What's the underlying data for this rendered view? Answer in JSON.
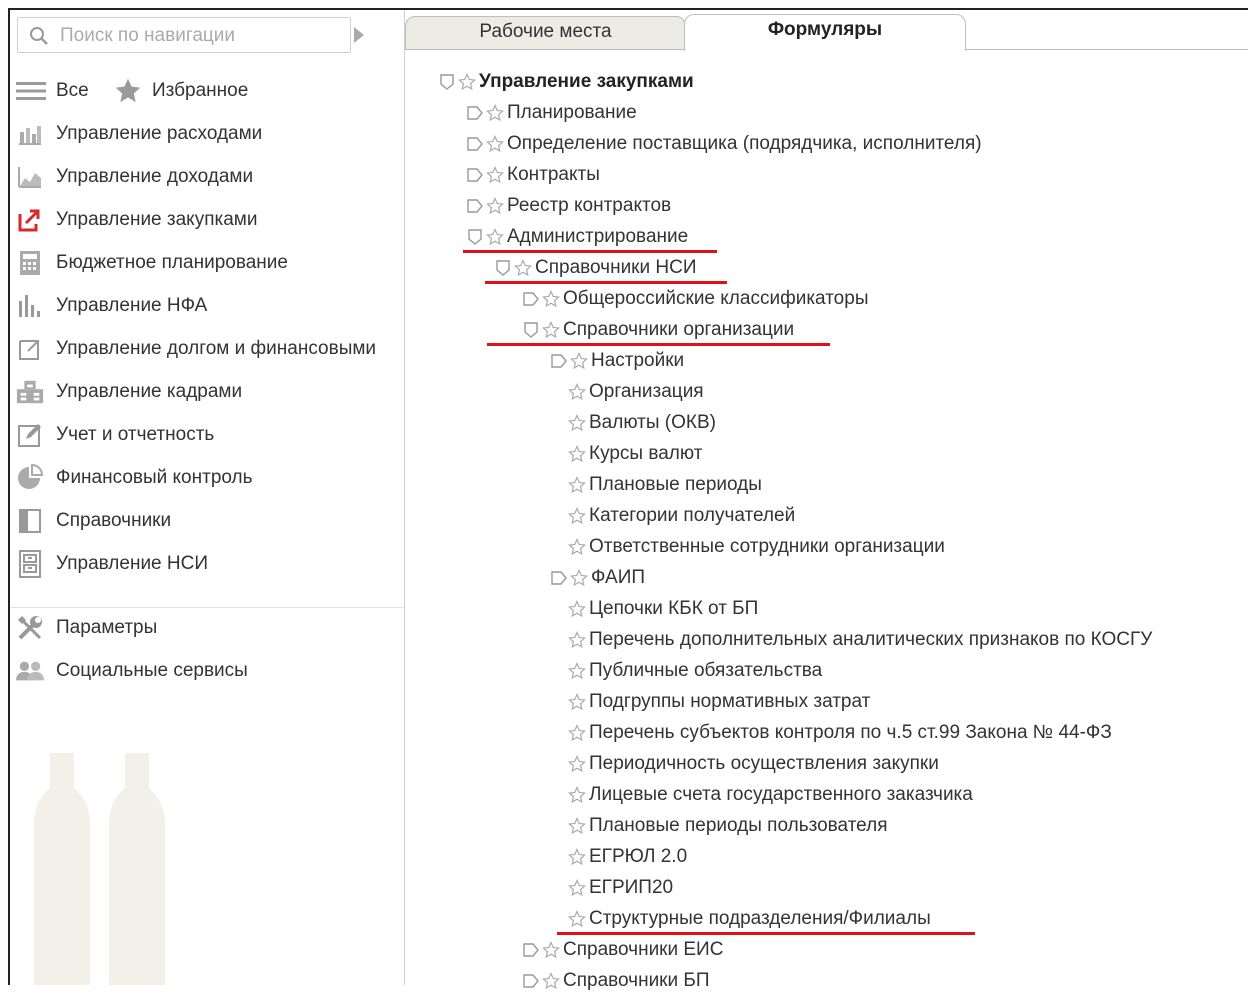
{
  "search": {
    "placeholder": "Поиск по навигации"
  },
  "nav": {
    "all_label": "Все",
    "favorites_label": "Избранное",
    "items": [
      {
        "label": "Управление расходами",
        "icon": "bar-chart-icon"
      },
      {
        "label": "Управление доходами",
        "icon": "area-chart-icon"
      },
      {
        "label": "Управление закупками",
        "icon": "procurement-icon"
      },
      {
        "label": "Бюджетное планирование",
        "icon": "calculator-icon"
      },
      {
        "label": "Управление НФА",
        "icon": "columns-chart-icon"
      },
      {
        "label": "Управление долгом и финансовыми",
        "icon": "edit-frame-icon"
      },
      {
        "label": "Управление кадрами",
        "icon": "people-icon"
      },
      {
        "label": "Учет и отчетность",
        "icon": "report-pen-icon"
      },
      {
        "label": "Финансовый контроль",
        "icon": "pie-chart-icon"
      },
      {
        "label": "Справочники",
        "icon": "book-icon"
      },
      {
        "label": "Управление НСИ",
        "icon": "cabinet-icon"
      }
    ],
    "bottom": [
      {
        "label": "Параметры",
        "icon": "tools-icon"
      },
      {
        "label": "Социальные сервисы",
        "icon": "users-icon"
      }
    ]
  },
  "tabs": [
    {
      "label": "Рабочие места",
      "active": false
    },
    {
      "label": "Формуляры",
      "active": true
    }
  ],
  "tree": [
    {
      "label": "Управление закупками",
      "level": 0,
      "node": "open",
      "bold": true
    },
    {
      "label": "Планирование",
      "level": 1,
      "node": "closed"
    },
    {
      "label": "Определение поставщика (подрядчика, исполнителя)",
      "level": 1,
      "node": "closed"
    },
    {
      "label": "Контракты",
      "level": 1,
      "node": "closed"
    },
    {
      "label": "Реестр контрактов",
      "level": 1,
      "node": "closed"
    },
    {
      "label": "Администрирование",
      "level": 1,
      "node": "open",
      "underline": true
    },
    {
      "label": "Справочники НСИ",
      "level": 2,
      "node": "open",
      "underline": true
    },
    {
      "label": "Общероссийские классификаторы",
      "level": 3,
      "node": "closed"
    },
    {
      "label": "Справочники организации",
      "level": 3,
      "node": "open",
      "underline": true
    },
    {
      "label": "Настройки",
      "level": 4,
      "node": "closed"
    },
    {
      "label": "Организация",
      "level": 4,
      "node": "leaf"
    },
    {
      "label": "Валюты (ОКВ)",
      "level": 4,
      "node": "leaf"
    },
    {
      "label": "Курсы валют",
      "level": 4,
      "node": "leaf"
    },
    {
      "label": "Плановые периоды",
      "level": 4,
      "node": "leaf"
    },
    {
      "label": "Категории получателей",
      "level": 4,
      "node": "leaf"
    },
    {
      "label": "Ответственные сотрудники организации",
      "level": 4,
      "node": "leaf"
    },
    {
      "label": "ФАИП",
      "level": 4,
      "node": "closed"
    },
    {
      "label": "Цепочки КБК от БП",
      "level": 4,
      "node": "leaf"
    },
    {
      "label": "Перечень дополнительных аналитических признаков по КОСГУ",
      "level": 4,
      "node": "leaf"
    },
    {
      "label": "Публичные обязательства",
      "level": 4,
      "node": "leaf"
    },
    {
      "label": "Подгруппы нормативных затрат",
      "level": 4,
      "node": "leaf"
    },
    {
      "label": "Перечень субъектов контроля по ч.5 ст.99 Закона № 44-ФЗ",
      "level": 4,
      "node": "leaf"
    },
    {
      "label": "Периодичность осуществления закупки",
      "level": 4,
      "node": "leaf"
    },
    {
      "label": "Лицевые счета государственного заказчика",
      "level": 4,
      "node": "leaf"
    },
    {
      "label": "Плановые периоды пользователя",
      "level": 4,
      "node": "leaf"
    },
    {
      "label": "ЕГРЮЛ 2.0",
      "level": 4,
      "node": "leaf"
    },
    {
      "label": "ЕГРИП20",
      "level": 4,
      "node": "leaf"
    },
    {
      "label": "Структурные подразделения/Филиалы",
      "level": 4,
      "node": "leaf",
      "underline": true
    },
    {
      "label": "Справочники ЕИС",
      "level": 3,
      "node": "closed"
    },
    {
      "label": "Справочники БП",
      "level": 3,
      "node": "closed"
    }
  ],
  "colors": {
    "highlight_underline": "#e0101a",
    "procurement_icon": "#d42a2a",
    "tab_inactive_bg": "#ecebe4"
  }
}
